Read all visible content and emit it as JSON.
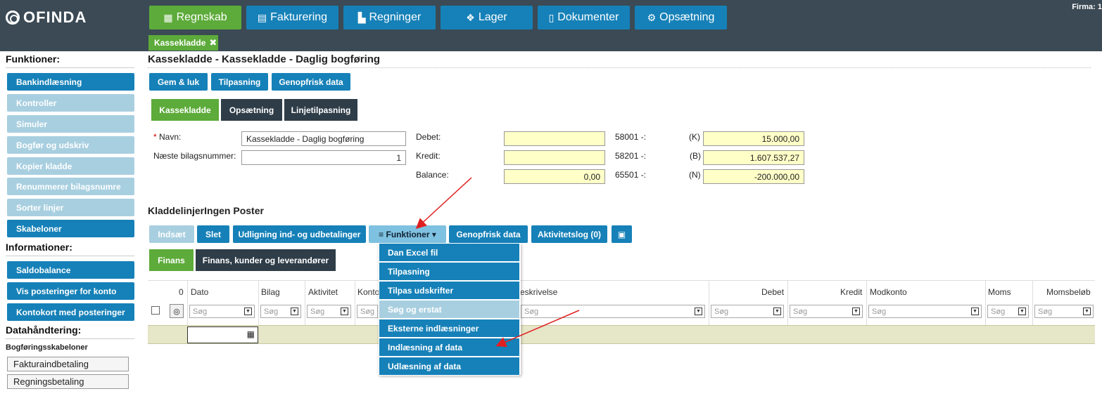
{
  "app": {
    "logo": "OFINDA",
    "firma": "Firma: 1"
  },
  "nav": [
    {
      "label": "Regnskab",
      "icon": "calendar-icon"
    },
    {
      "label": "Fakturering",
      "icon": "clipboard-icon"
    },
    {
      "label": "Regninger",
      "icon": "chart-icon"
    },
    {
      "label": "Lager",
      "icon": "cubes-icon"
    },
    {
      "label": "Dokumenter",
      "icon": "document-icon"
    },
    {
      "label": "Opsætning",
      "icon": "gear-icon"
    }
  ],
  "open_tab": {
    "label": "Kassekladde",
    "close": "✖"
  },
  "sidebar": {
    "funktioner_heading": "Funktioner:",
    "funktioner": [
      "Bankindlæsning",
      "Kontroller",
      "Simuler",
      "Bogfør og udskriv",
      "Kopier kladde",
      "Renummerer bilagsnumre",
      "Sorter linjer",
      "Skabeloner"
    ],
    "informationer_heading": "Informationer:",
    "informationer": [
      "Saldobalance",
      "Vis posteringer for konto",
      "Kontokort med posteringer"
    ],
    "data_heading": "Datahåndtering:",
    "templates_heading": "Bogføringsskabeloner",
    "templates": [
      "Fakturaindbetaling",
      "Regningsbetaling"
    ]
  },
  "page": {
    "title": "Kassekladde - Kassekladde - Daglig bogføring",
    "actions": [
      "Gem & luk",
      "Tilpasning",
      "Genopfrisk data"
    ],
    "tabs": [
      "Kassekladde",
      "Opsætning",
      "Linjetilpasning"
    ]
  },
  "form": {
    "navn_label": "Navn:",
    "navn_required": "*",
    "navn_value": "Kassekladde - Daglig bogføring",
    "bilag_label": "Næste bilagsnummer:",
    "bilag_value": "1",
    "debet_label": "Debet:",
    "kredit_label": "Kredit:",
    "balance_label": "Balance:",
    "debet_value": "",
    "kredit_value": "",
    "balance_value": "0,00",
    "acc1": "58001 -:",
    "acc2": "58201 -:",
    "acc3": "65501 -:",
    "tag1": "(K)",
    "tag2": "(B)",
    "tag3": "(N)",
    "amt1": "15.000,00",
    "amt2": "1.607.537,27",
    "amt3": "-200.000,00"
  },
  "lines": {
    "heading": "KladdelinjerIngen Poster",
    "toolbar": [
      "Indsæt",
      "Slet",
      "Udligning ind- og udbetalinger",
      "Funktioner",
      "Genopfrisk data",
      "Aktivitetslog (0)"
    ],
    "subtabs": [
      "Finans",
      "Finans, kunder og leverandører"
    ],
    "columns": {
      "count": "0",
      "dato": "Dato",
      "bilag": "Bilag",
      "aktivitet": "Aktivitet",
      "konto": "Konto",
      "beskrivelse": "eskrivelse",
      "debet": "Debet",
      "kredit": "Kredit",
      "modkonto": "Modkonto",
      "moms": "Moms",
      "momsbelob": "Momsbeløb"
    },
    "filter_placeholder": "Søg"
  },
  "menu": {
    "items": [
      "Dan Excel fil",
      "Tilpasning",
      "Tilpas udskrifter",
      "Søg og erstat",
      "Eksterne indlæsninger",
      "Indlæsning af data",
      "Udlæsning af data"
    ]
  },
  "colors": {
    "primary": "#1681b8",
    "active": "#5dab3a",
    "dark": "#3b4a55",
    "disabled": "#a8cfe0",
    "highlight": "#ffffc8",
    "annotation": "#e02020"
  }
}
